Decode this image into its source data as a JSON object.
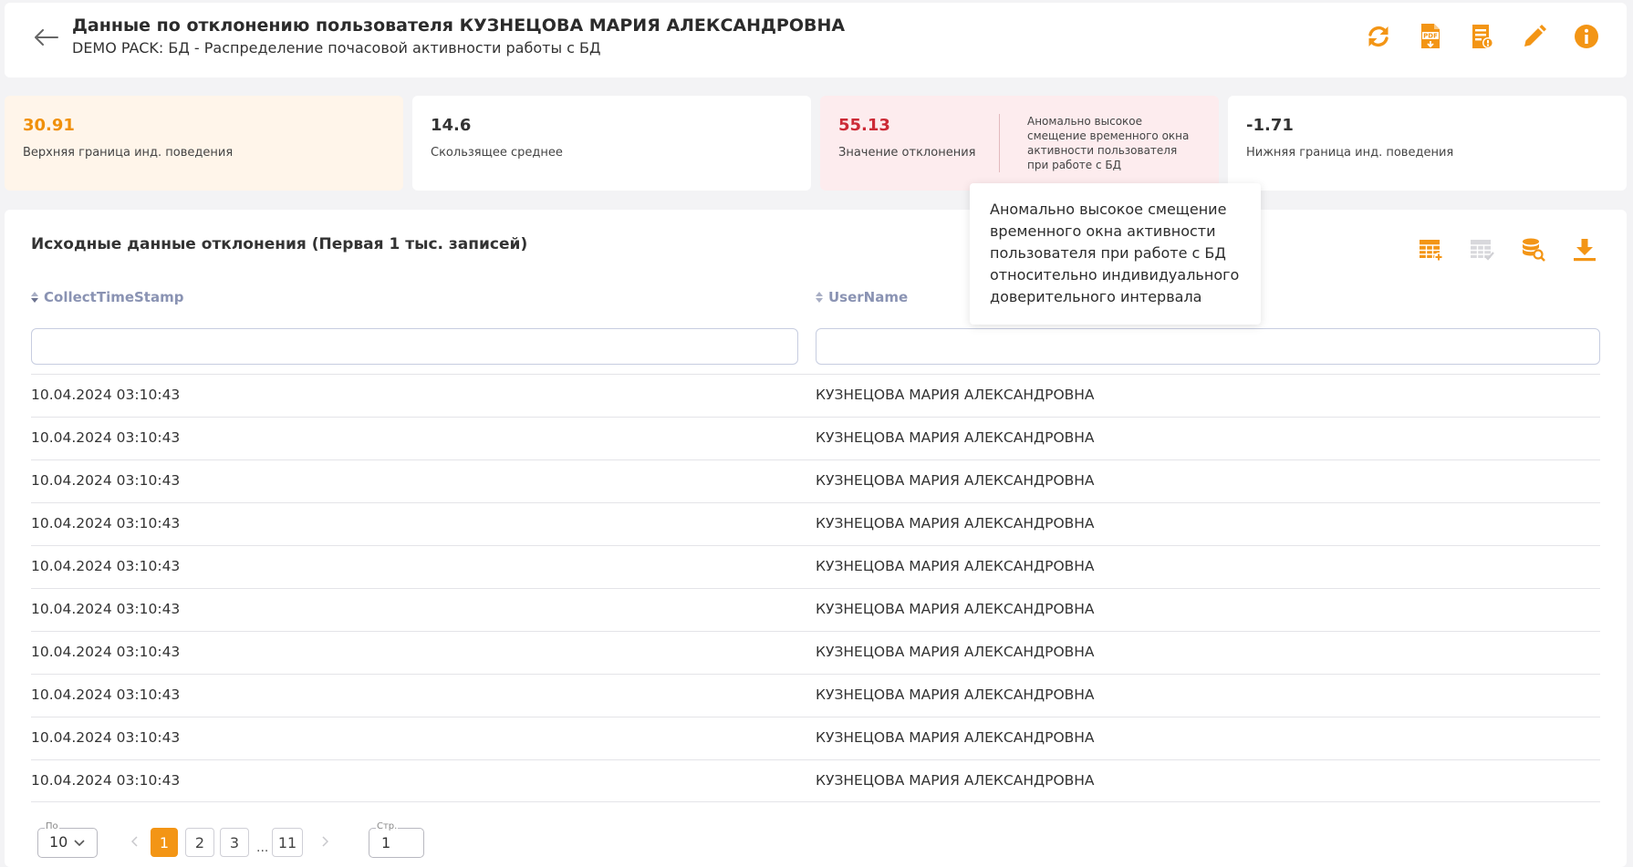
{
  "header": {
    "title": "Данные по отклонению пользователя КУЗНЕЦОВА МАРИЯ АЛЕКСАНДРОВНА",
    "subtitle": "DEMO PACK: БД - Распределение почасовой активности работы с БД",
    "icons": [
      "refresh-icon",
      "pdf-export-icon",
      "report-icon",
      "edit-icon",
      "info-icon"
    ]
  },
  "cards": {
    "upper": {
      "value": "30.91",
      "label": "Верхняя граница инд. поведения"
    },
    "average": {
      "value": "14.6",
      "label": "Скользящее среднее"
    },
    "deviation": {
      "value": "55.13",
      "label": "Значение отклонения",
      "description": "Аномально высокое смещение временного окна активности пользователя при работе с БД относительно индивидуаль..."
    },
    "lower": {
      "value": "-1.71",
      "label": "Нижняя граница инд. поведения"
    }
  },
  "table": {
    "title": "Исходные данные отклонения (Первая 1 тыс. записей)",
    "columns": [
      "CollectTimeStamp",
      "UserName"
    ],
    "rows": [
      [
        "10.04.2024 03:10:43",
        "КУЗНЕЦОВА МАРИЯ АЛЕКСАНДРОВНА"
      ],
      [
        "10.04.2024 03:10:43",
        "КУЗНЕЦОВА МАРИЯ АЛЕКСАНДРОВНА"
      ],
      [
        "10.04.2024 03:10:43",
        "КУЗНЕЦОВА МАРИЯ АЛЕКСАНДРОВНА"
      ],
      [
        "10.04.2024 03:10:43",
        "КУЗНЕЦОВА МАРИЯ АЛЕКСАНДРОВНА"
      ],
      [
        "10.04.2024 03:10:43",
        "КУЗНЕЦОВА МАРИЯ АЛЕКСАНДРОВНА"
      ],
      [
        "10.04.2024 03:10:43",
        "КУЗНЕЦОВА МАРИЯ АЛЕКСАНДРОВНА"
      ],
      [
        "10.04.2024 03:10:43",
        "КУЗНЕЦОВА МАРИЯ АЛЕКСАНДРОВНА"
      ],
      [
        "10.04.2024 03:10:43",
        "КУЗНЕЦОВА МАРИЯ АЛЕКСАНДРОВНА"
      ],
      [
        "10.04.2024 03:10:43",
        "КУЗНЕЦОВА МАРИЯ АЛЕКСАНДРОВНА"
      ],
      [
        "10.04.2024 03:10:43",
        "КУЗНЕЦОВА МАРИЯ АЛЕКСАНДРОВНА"
      ]
    ],
    "icons": [
      "table-add-icon",
      "table-check-icon",
      "database-search-icon",
      "download-icon"
    ]
  },
  "pagination": {
    "per_page_label": "По",
    "per_page_value": "10",
    "pages": [
      "1",
      "2",
      "3",
      "11"
    ],
    "active_page": "1",
    "ellipsis": "...",
    "page_input_label": "Стр.",
    "page_input_value": "1"
  },
  "tooltip": {
    "text": "Аномально высокое смещение временного окна активности пользователя при работе с БД относительно индивидуального доверительного интервала"
  },
  "colors": {
    "accent": "#f39515",
    "danger": "#cc2a36",
    "header_text": "#8a93b3"
  }
}
